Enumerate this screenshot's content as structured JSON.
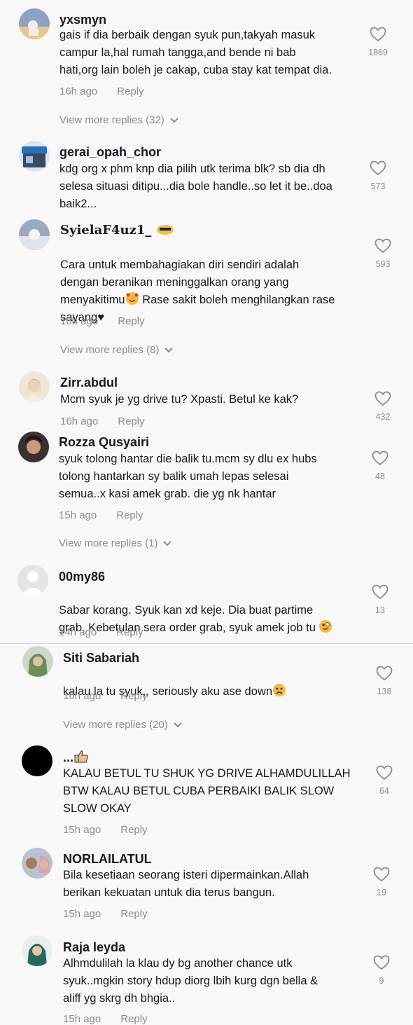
{
  "comments": [
    {
      "username": "yxsmyn",
      "text": "gais if dia berbaik dengan syuk pun,takyah masuk\ncampur la,hal rumah tangga,and bende ni bab\nhati,org lain boleh je cakap, cuba stay kat tempat dia.",
      "time": "16h ago",
      "reply": "Reply",
      "likes": "1869",
      "more": "View more replies (32)"
    },
    {
      "username": "gerai_opah_chor",
      "text": "kdg org x phm knp dia pilih utk terima blk? sb dia dh\nselesa situasi ditipu...dia bole handle..so let it be..doa\nbaik2...",
      "likes": "573"
    },
    {
      "username": "SyielaF4uz1_",
      "text1": "Cara untuk membahagiakan diri sendiri adalah\ndengan beranikan meninggalkan orang yang\nmenyakitimu",
      "text2": " Rase sakit boleh menghilangkan rase\nsayang♥",
      "time": "16h ago",
      "reply": "Reply",
      "likes": "593",
      "more": "View more replies (8)"
    },
    {
      "username": "Zirr.abdul",
      "text": "Mcm syuk je yg drive tu? Xpasti. Betul ke kak?",
      "time": "16h ago",
      "reply": "Reply",
      "likes": "432"
    },
    {
      "username": "Rozza Qusyairi",
      "text": "syuk tolong hantar die balik tu.mcm sy dlu ex hubs\ntolong hantarkan sy balik umah lepas selesai\nsemua..x kasi amek grab. die yg nk hantar",
      "time": "15h ago",
      "reply": "Reply",
      "likes": "48",
      "more": "View more replies (1)"
    },
    {
      "username": "00my86",
      "text": "Sabar korang. Syuk kan xd keje. Dia buat partime\ngrab. Kebetulan sera order grab, syuk amek job tu ",
      "time": "14h ago",
      "reply": "Reply",
      "likes": "13"
    },
    {
      "username": "Siti Sabariah",
      "text": "kalau la tu syuk,, seriously aku ase down",
      "time": "16h ago",
      "reply": "Reply",
      "likes": "138",
      "more": "View more replies (20)"
    },
    {
      "username": "...",
      "text": "KALAU BETUL TU SHUK YG DRIVE ALHAMDULILLAH\nBTW KALAU BETUL CUBA PERBAIKI BALIK SLOW\nSLOW OKAY",
      "time": "15h ago",
      "reply": "Reply",
      "likes": "64"
    },
    {
      "username": "NORLAILATUL",
      "text": "Bila kesetiaan seorang isteri dipermainkan.Allah\nberikan kekuatan untuk dia terus bangun.",
      "time": "15h ago",
      "reply": "Reply",
      "likes": "19"
    },
    {
      "username": "Raja leyda",
      "text": "Alhmdulilah la klau dy bg another chance utk\nsyuk..mgkin story hdup diorg lbih kurg dgn bella &\naliff yg skrg dh bhgia..",
      "time": "15h ago",
      "reply": "Reply",
      "likes": "9"
    }
  ],
  "colors": {
    "text": "#161823",
    "muted": "#8a8b91",
    "background": "#f8f8f8",
    "divider": "#d9d9d9"
  }
}
